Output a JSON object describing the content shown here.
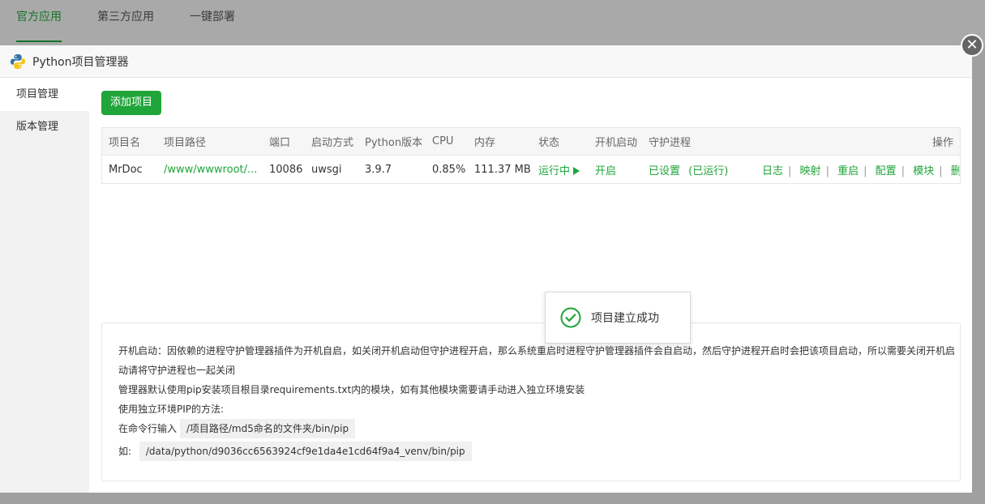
{
  "bg_tabs": [
    "官方应用",
    "第三方应用",
    "一键部署"
  ],
  "modal": {
    "title": "Python项目管理器",
    "close_glyph": "✕"
  },
  "sidebar": {
    "items": [
      {
        "label": "项目管理",
        "active": true
      },
      {
        "label": "版本管理",
        "active": false
      }
    ]
  },
  "toolbar": {
    "add_label": "添加项目"
  },
  "table": {
    "headers": [
      "项目名",
      "项目路径",
      "端口",
      "启动方式",
      "Python版本",
      "CPU",
      "内存",
      "状态",
      "开机启动",
      "守护进程",
      "操作"
    ],
    "rows": [
      {
        "name": "MrDoc",
        "path": "/www/wwwroot/...",
        "port": "10086",
        "start_mode": "uwsgi",
        "python_version": "3.9.7",
        "cpu": "0.85%",
        "memory": "111.37 MB",
        "status": "运行中",
        "boot": "开启",
        "daemon": "已设置",
        "daemon_state": "(已运行)",
        "ops": [
          "日志",
          "映射",
          "重启",
          "配置",
          "模块",
          "删除"
        ]
      }
    ]
  },
  "notes": {
    "line1": "开机启动：因依赖的进程守护管理器插件为开机自启，如关闭开机启动但守护进程开启，那么系统重启时进程守护管理器插件会自启动，然后守护进程开启时会把该项目启动，所以需要关闭开机启",
    "line1b": "动请将守护进程也一起关闭",
    "line2": "管理器默认使用pip安装项目根目录requirements.txt内的模块，如有其他模块需要请手动进入独立环境安装",
    "line3": "使用独立环境PIP的方法:",
    "line4_prefix": "在命令行输入",
    "line4_code": "/项目路径/md5命名的文件夹/bin/pip",
    "line5_prefix": "如:",
    "line5_code": "/data/python/d9036cc6563924cf9e1da4e1cd64f9a4_venv/bin/pip"
  },
  "toast": {
    "message": "项目建立成功"
  },
  "colors": {
    "accent": "#20a53a"
  }
}
